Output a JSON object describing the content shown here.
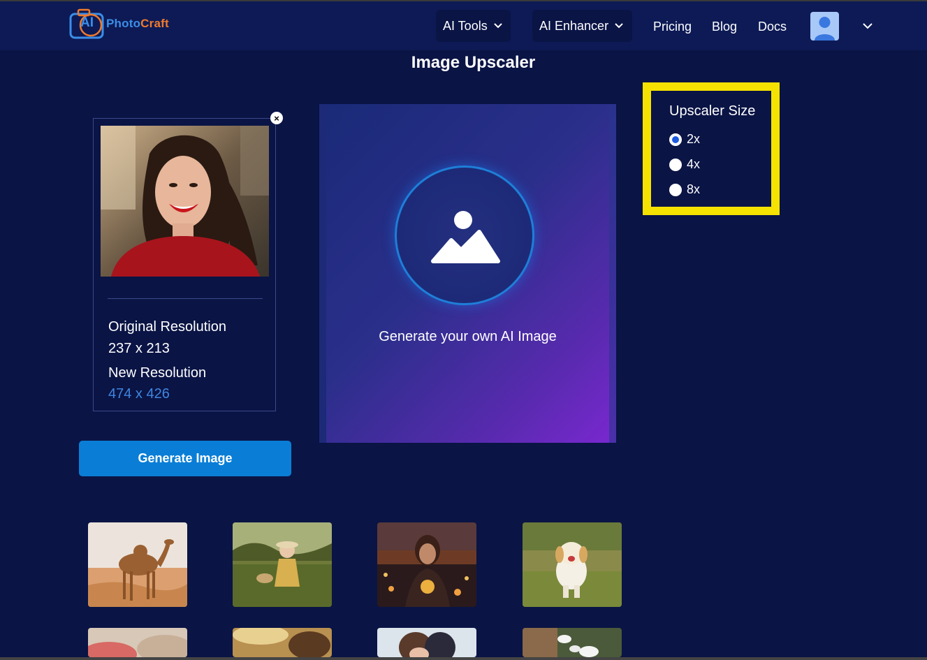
{
  "brand": {
    "logo_ai": "AI",
    "logo_photo": "Photo",
    "logo_craft": "Craft"
  },
  "nav": {
    "ai_tools": "AI Tools",
    "ai_enhancer": "AI Enhancer",
    "pricing": "Pricing",
    "blog": "Blog",
    "docs": "Docs"
  },
  "page": {
    "title": "Image Upscaler"
  },
  "upload_card": {
    "original_label": "Original Resolution",
    "original_value": "237 x 213",
    "new_label": "New Resolution",
    "new_value": "474 x 426",
    "close_glyph": "×"
  },
  "generate_button": "Generate Image",
  "canvas": {
    "text": "Generate your own AI Image"
  },
  "upscaler": {
    "title": "Upscaler Size",
    "options": [
      {
        "label": "2x",
        "checked": true
      },
      {
        "label": "4x",
        "checked": false
      },
      {
        "label": "8x",
        "checked": false
      }
    ]
  },
  "gallery": {
    "thumbnails": [
      "camel",
      "child-in-field",
      "woman-with-lights",
      "puppy",
      "red-blur",
      "sunlit-outdoor",
      "children",
      "white-flowers"
    ]
  },
  "colors": {
    "background": "#0a1445",
    "nav": "#0d1a55",
    "accent_button": "#0a7ed6",
    "highlight": "#f6e200",
    "link_blue": "#3f86e0"
  }
}
